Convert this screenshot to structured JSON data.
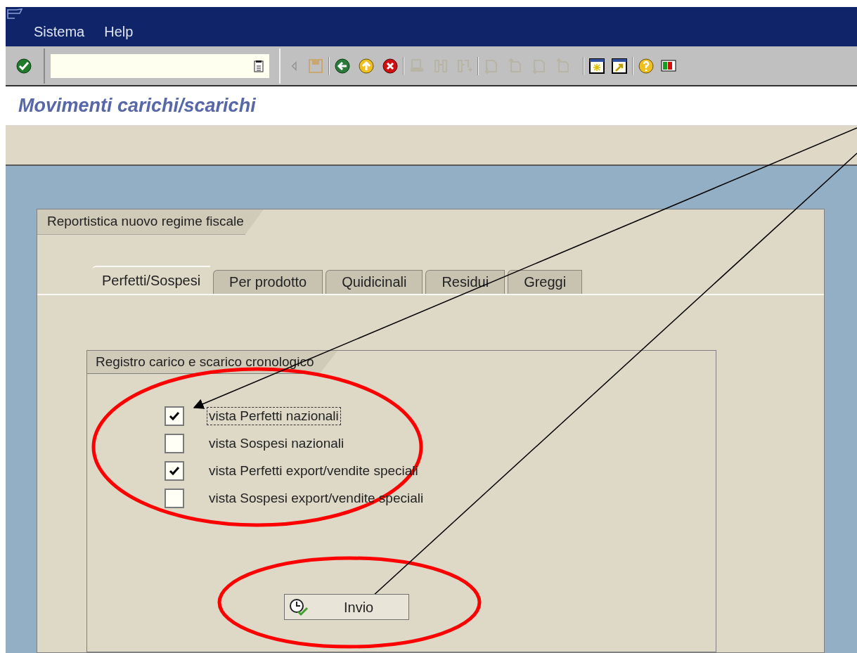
{
  "menu_bar": {
    "items": [
      "Sistema",
      "Help"
    ]
  },
  "screen_title": "Movimenti carichi/scarichi",
  "group_box": {
    "title": "Reportistica nuovo regime fiscale",
    "tabs": [
      {
        "label": "Perfetti/Sospesi",
        "selected": true
      },
      {
        "label": "Per prodotto",
        "selected": false
      },
      {
        "label": "Quidicinali",
        "selected": false
      },
      {
        "label": "Residui",
        "selected": false
      },
      {
        "label": "Greggi",
        "selected": false
      }
    ],
    "frame": {
      "title": "Registro carico e scarico cronologico",
      "options": [
        {
          "label": "vista Perfetti nazionali",
          "checked": true,
          "focused": true
        },
        {
          "label": "vista Sospesi nazionali",
          "checked": false,
          "focused": false
        },
        {
          "label": "vista Perfetti export/vendite speciali",
          "checked": true,
          "focused": false
        },
        {
          "label": "vista Sospesi export/vendite speciali",
          "checked": false,
          "focused": false
        }
      ],
      "button": {
        "label": "Invio"
      }
    }
  }
}
